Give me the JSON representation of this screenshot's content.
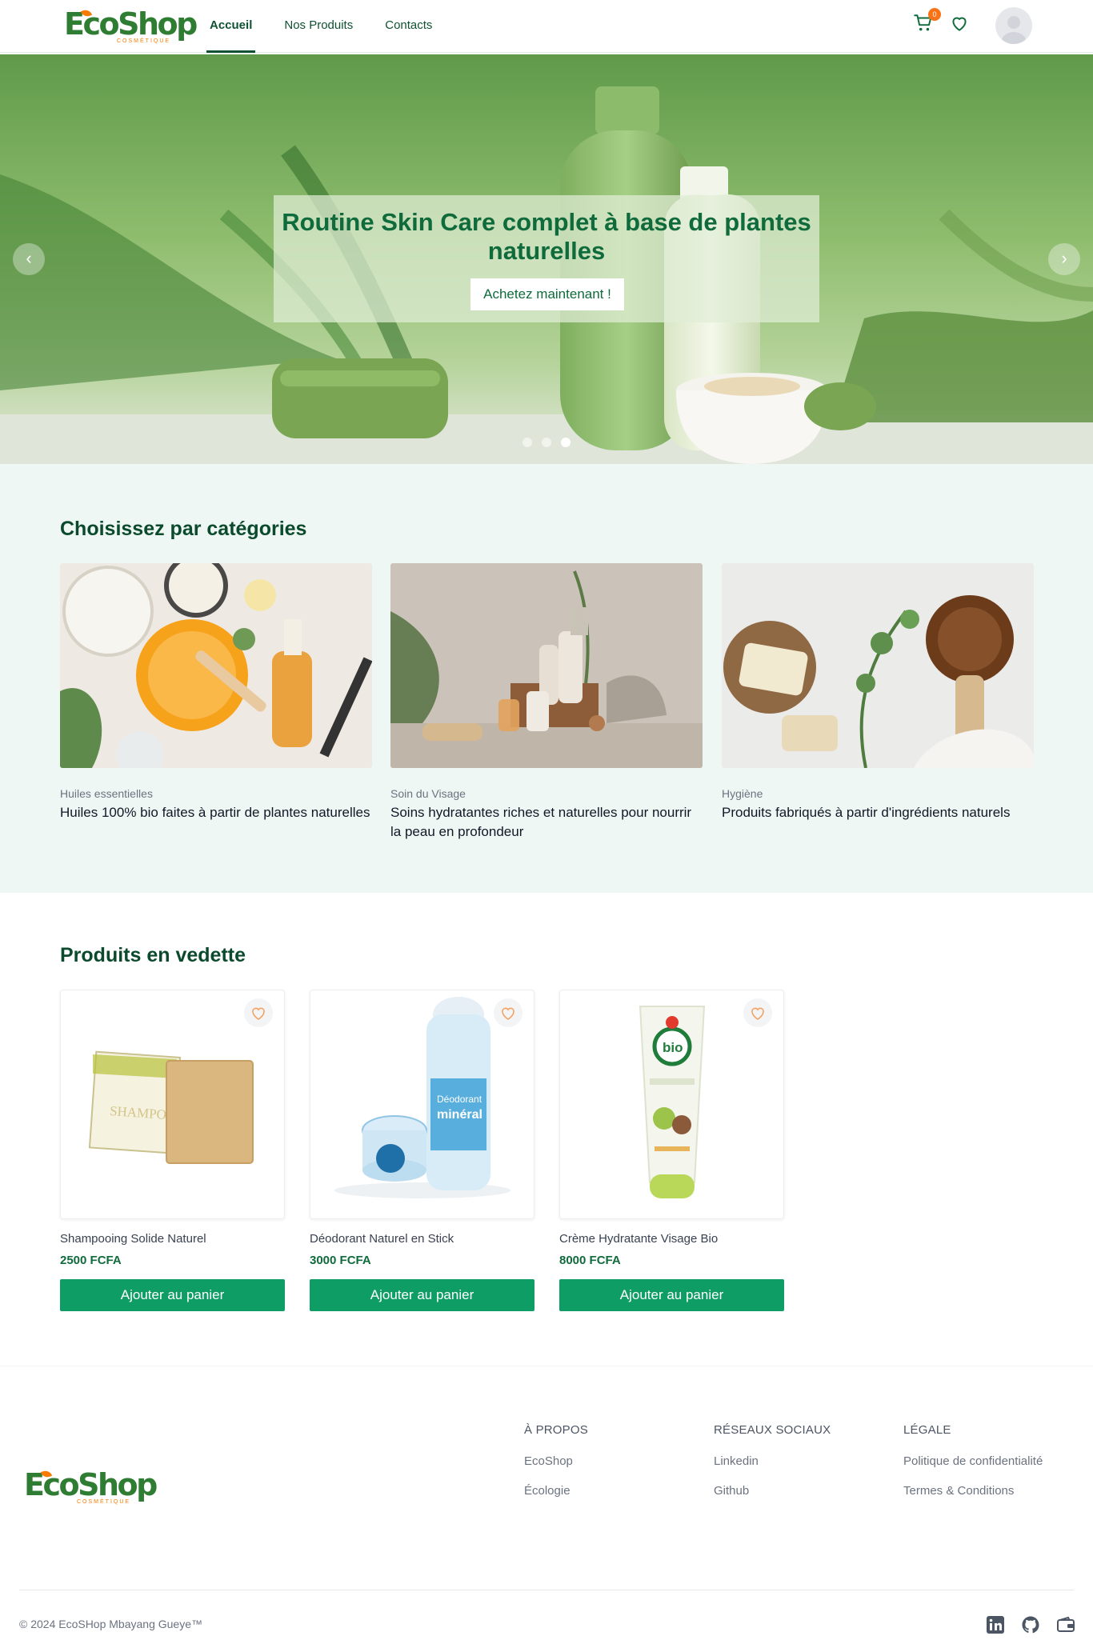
{
  "brand": {
    "name": "EcoShop",
    "tagline": "COSMÉTIQUE"
  },
  "header": {
    "nav": [
      "Accueil",
      "Nos Produits",
      "Contacts"
    ],
    "active_nav": "Accueil",
    "cart_count": "0",
    "icons": [
      "cart-icon",
      "heart-icon",
      "user-avatar-icon"
    ]
  },
  "hero": {
    "title": "Routine Skin Care complet à base de plantes naturelles",
    "cta": "Achetez maintenant !",
    "slides": 3,
    "active_slide": 3
  },
  "categories": {
    "title": "Choisissez par catégories",
    "items": [
      {
        "label": "Huiles essentielles",
        "description": "Huiles 100% bio faites à partir de plantes naturelles"
      },
      {
        "label": "Soin du Visage",
        "description": "Soins hydratantes riches et naturelles pour nourrir la peau en profondeur"
      },
      {
        "label": "Hygiène",
        "description": "Produits fabriqués à partir d'ingrédients naturels"
      }
    ]
  },
  "featured": {
    "title": "Produits en vedette",
    "add_to_cart_label": "Ajouter au panier",
    "products": [
      {
        "name": "Shampooing Solide Naturel",
        "price": "2500 FCFA"
      },
      {
        "name": "Déodorant Naturel en Stick",
        "price": "3000 FCFA"
      },
      {
        "name": "Crème Hydratante Visage Bio",
        "price": "8000 FCFA"
      }
    ]
  },
  "footer": {
    "columns": [
      {
        "heading": "À PROPOS",
        "links": [
          "EcoShop",
          "Écologie"
        ]
      },
      {
        "heading": "RÉSEAUX SOCIAUX",
        "links": [
          "Linkedin",
          "Github"
        ]
      },
      {
        "heading": "LÉGALE",
        "links": [
          "Politique de confidentialité",
          "Termes & Conditions"
        ]
      }
    ],
    "copyright": "© 2024 EcoSHop Mbayang Gueye™",
    "social_icons": [
      "linkedin-icon",
      "github-icon",
      "wallet-icon"
    ]
  },
  "colors": {
    "primary": "#0f9d66",
    "brand_green": "#2e7d32",
    "accent_orange": "#f97316",
    "heading": "#0b4a2c",
    "category_bg": "#eff7f4"
  }
}
